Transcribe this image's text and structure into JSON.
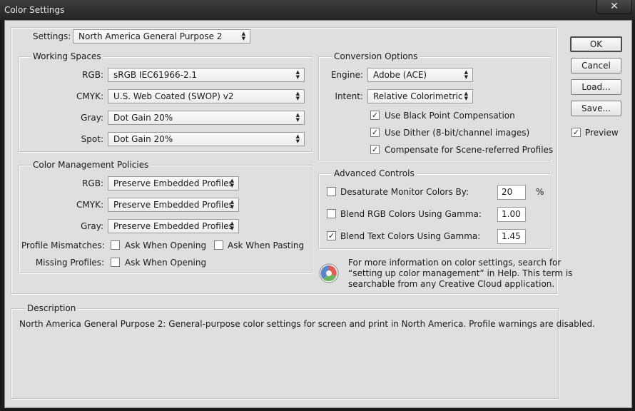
{
  "window": {
    "title": "Color Settings",
    "close_glyph": "✕"
  },
  "settings": {
    "label": "Settings:",
    "value": "North America General Purpose 2"
  },
  "working_spaces": {
    "title": "Working Spaces",
    "rgb": {
      "label": "RGB:",
      "value": "sRGB IEC61966-2.1"
    },
    "cmyk": {
      "label": "CMYK:",
      "value": "U.S. Web Coated (SWOP) v2"
    },
    "gray": {
      "label": "Gray:",
      "value": "Dot Gain 20%"
    },
    "spot": {
      "label": "Spot:",
      "value": "Dot Gain 20%"
    }
  },
  "policies": {
    "title": "Color Management Policies",
    "rgb": {
      "label": "RGB:",
      "value": "Preserve Embedded Profiles"
    },
    "cmyk": {
      "label": "CMYK:",
      "value": "Preserve Embedded Profiles"
    },
    "gray": {
      "label": "Gray:",
      "value": "Preserve Embedded Profiles"
    },
    "mismatch_label": "Profile Mismatches:",
    "ask_opening": {
      "label": "Ask When Opening",
      "checked": false
    },
    "ask_pasting": {
      "label": "Ask When Pasting",
      "checked": false
    },
    "missing_label": "Missing Profiles:",
    "missing_ask_opening": {
      "label": "Ask When Opening",
      "checked": false
    }
  },
  "conversion": {
    "title": "Conversion Options",
    "engine": {
      "label": "Engine:",
      "value": "Adobe (ACE)"
    },
    "intent": {
      "label": "Intent:",
      "value": "Relative Colorimetric"
    },
    "black_point": {
      "label": "Use Black Point Compensation",
      "checked": true
    },
    "dither": {
      "label": "Use Dither (8-bit/channel images)",
      "checked": true
    },
    "scene": {
      "label": "Compensate for Scene-referred Profiles",
      "checked": true
    }
  },
  "advanced": {
    "title": "Advanced Controls",
    "desaturate": {
      "label": "Desaturate Monitor Colors By:",
      "value": "20",
      "unit": "%",
      "checked": false
    },
    "blend_rgb": {
      "label": "Blend RGB Colors Using Gamma:",
      "value": "1.00",
      "checked": false
    },
    "blend_text": {
      "label": "Blend Text Colors Using Gamma:",
      "value": "1.45",
      "checked": true
    }
  },
  "info": {
    "line1": "For more information on color settings, search for",
    "line2": "“setting up color management” in Help. This term is",
    "line3": "searchable from any Creative Cloud application."
  },
  "buttons": {
    "ok": "OK",
    "cancel": "Cancel",
    "load": "Load...",
    "save": "Save...",
    "preview": "Preview",
    "preview_checked": true
  },
  "description": {
    "title": "Description",
    "text": "North America General Purpose 2:  General-purpose color settings for screen and print in North America. Profile warnings are disabled."
  },
  "icons": {
    "check": "✓",
    "close": "close-icon",
    "info": "color-wheel-icon"
  }
}
